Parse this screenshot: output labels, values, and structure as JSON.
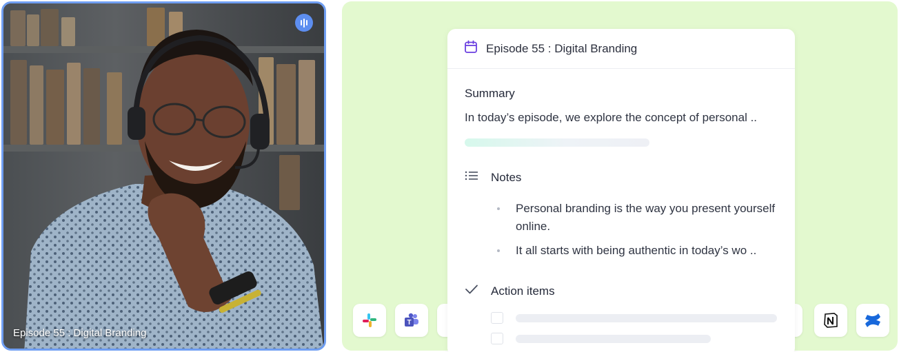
{
  "video": {
    "caption": "Episode 55 : Digital Branding",
    "speaking_icon": "audio-wave-icon",
    "border_color": "#6f9ef2"
  },
  "card": {
    "title": "Episode 55 : Digital Branding",
    "title_icon": "calendar-icon",
    "summary_label": "Summary",
    "summary_text": "In today’s episode, we explore the concept of personal ..",
    "notes_label": "Notes",
    "notes_icon": "list-icon",
    "notes": [
      "Personal branding is the way you present yourself online.",
      "It all starts with being authentic in today’s wo .."
    ],
    "action_label": "Action items",
    "action_icon": "checkmark-icon"
  },
  "integrations": [
    "slack-icon",
    "microsoft-teams-icon",
    "notion-icon",
    "confluence-icon"
  ],
  "colors": {
    "panel_bg": "#e3f9cf",
    "accent_purple": "#6a3fe0",
    "confluence_blue": "#1868db"
  }
}
